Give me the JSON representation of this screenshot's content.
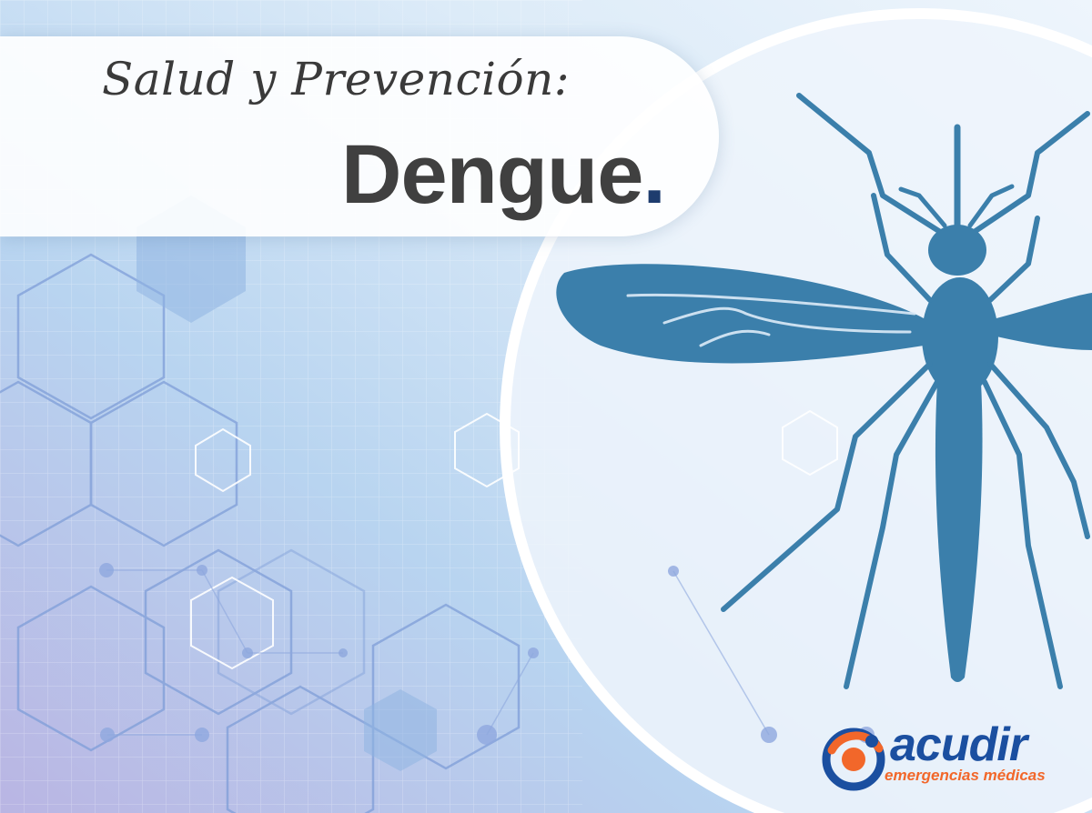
{
  "header": {
    "subtitle": "Salud y Prevención:",
    "title": "Dengue",
    "title_suffix": "."
  },
  "illustration": {
    "subject": "mosquito",
    "color": "#3b7fab"
  },
  "logo": {
    "name": "acudir",
    "tagline": "emergencias médicas",
    "name_color": "#1b4fa0",
    "accent_color": "#f2672a"
  },
  "colors": {
    "background_light": "#eaf3fb",
    "background_blue": "#b6d3ee",
    "background_violet": "#b3b2e0",
    "hexagon_line": "#7f9ed8"
  }
}
